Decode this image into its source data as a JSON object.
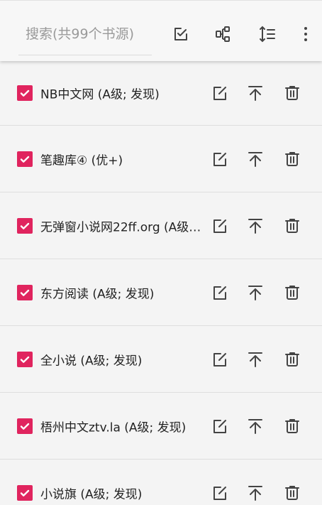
{
  "search": {
    "placeholder": "搜索(共99个书源)"
  },
  "toolbar": {
    "icons": [
      "select-all-icon",
      "group-icon",
      "sort-icon",
      "more-vert-icon"
    ]
  },
  "sources": [
    {
      "name": "NB中文网 (A级; 发现)",
      "checked": true
    },
    {
      "name": "笔趣库④ (优+)",
      "checked": true
    },
    {
      "name": "无弹窗小说网22ff.org (A级…",
      "checked": true
    },
    {
      "name": "东方阅读 (A级; 发现)",
      "checked": true
    },
    {
      "name": "全小说 (A级; 发现)",
      "checked": true
    },
    {
      "name": "梧州中文ztv.la (A级; 发现)",
      "checked": true
    },
    {
      "name": "小说旗 (A级; 发现)",
      "checked": true
    }
  ],
  "colors": {
    "accent": "#e0245e",
    "icon": "#444444"
  }
}
